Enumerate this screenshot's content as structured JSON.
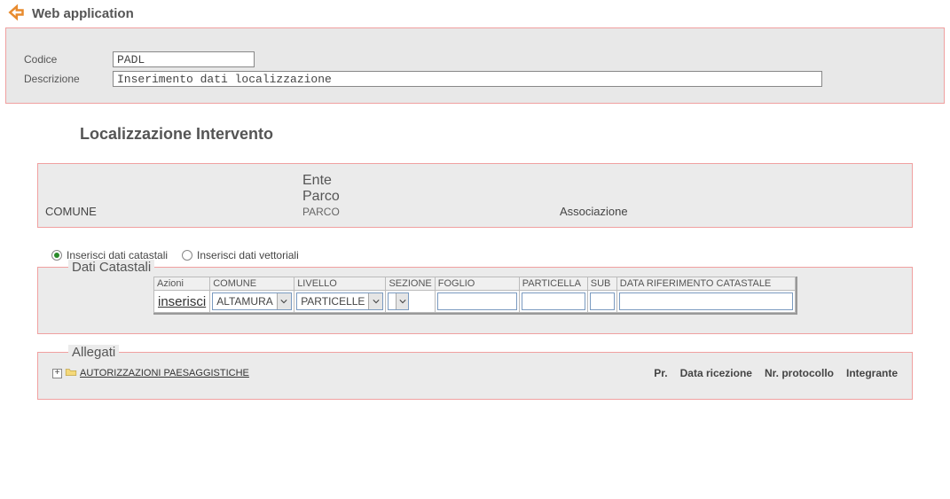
{
  "page_title": "Web application",
  "top_form": {
    "codice_label": "Codice",
    "codice_value": "PADL",
    "descrizione_label": "Descrizione",
    "descrizione_value": "Inserimento dati localizzazione"
  },
  "section_title": "Localizzazione Intervento",
  "loc_panel": {
    "comune_label": "COMUNE",
    "ente_line1": "Ente",
    "ente_line2": "Parco",
    "ente_small": "PARCO",
    "assoc_label": "Associazione"
  },
  "radios": {
    "opt1": "Inserisci dati catastali",
    "opt2": "Inserisci dati vettoriali"
  },
  "dati_catastali": {
    "legend": "Dati Catastali",
    "headers": {
      "azioni": "Azioni",
      "comune": "COMUNE",
      "livello": "LIVELLO",
      "sezione": "SEZIONE",
      "foglio": "FOGLIO",
      "particella": "PARTICELLA",
      "sub": "SUB",
      "data_rif": "DATA RIFERIMENTO CATASTALE"
    },
    "row": {
      "action": "inserisci",
      "comune_selected": "ALTAMURA",
      "livello_selected": "PARTICELLE",
      "sezione_selected": ""
    }
  },
  "allegati": {
    "legend": "Allegati",
    "tree_item": "AUTORIZZAZIONI PAESAGGISTICHE",
    "cols": {
      "pr": "Pr.",
      "data_ric": "Data ricezione",
      "nr_prot": "Nr. protocollo",
      "integrante": "Integrante"
    }
  }
}
